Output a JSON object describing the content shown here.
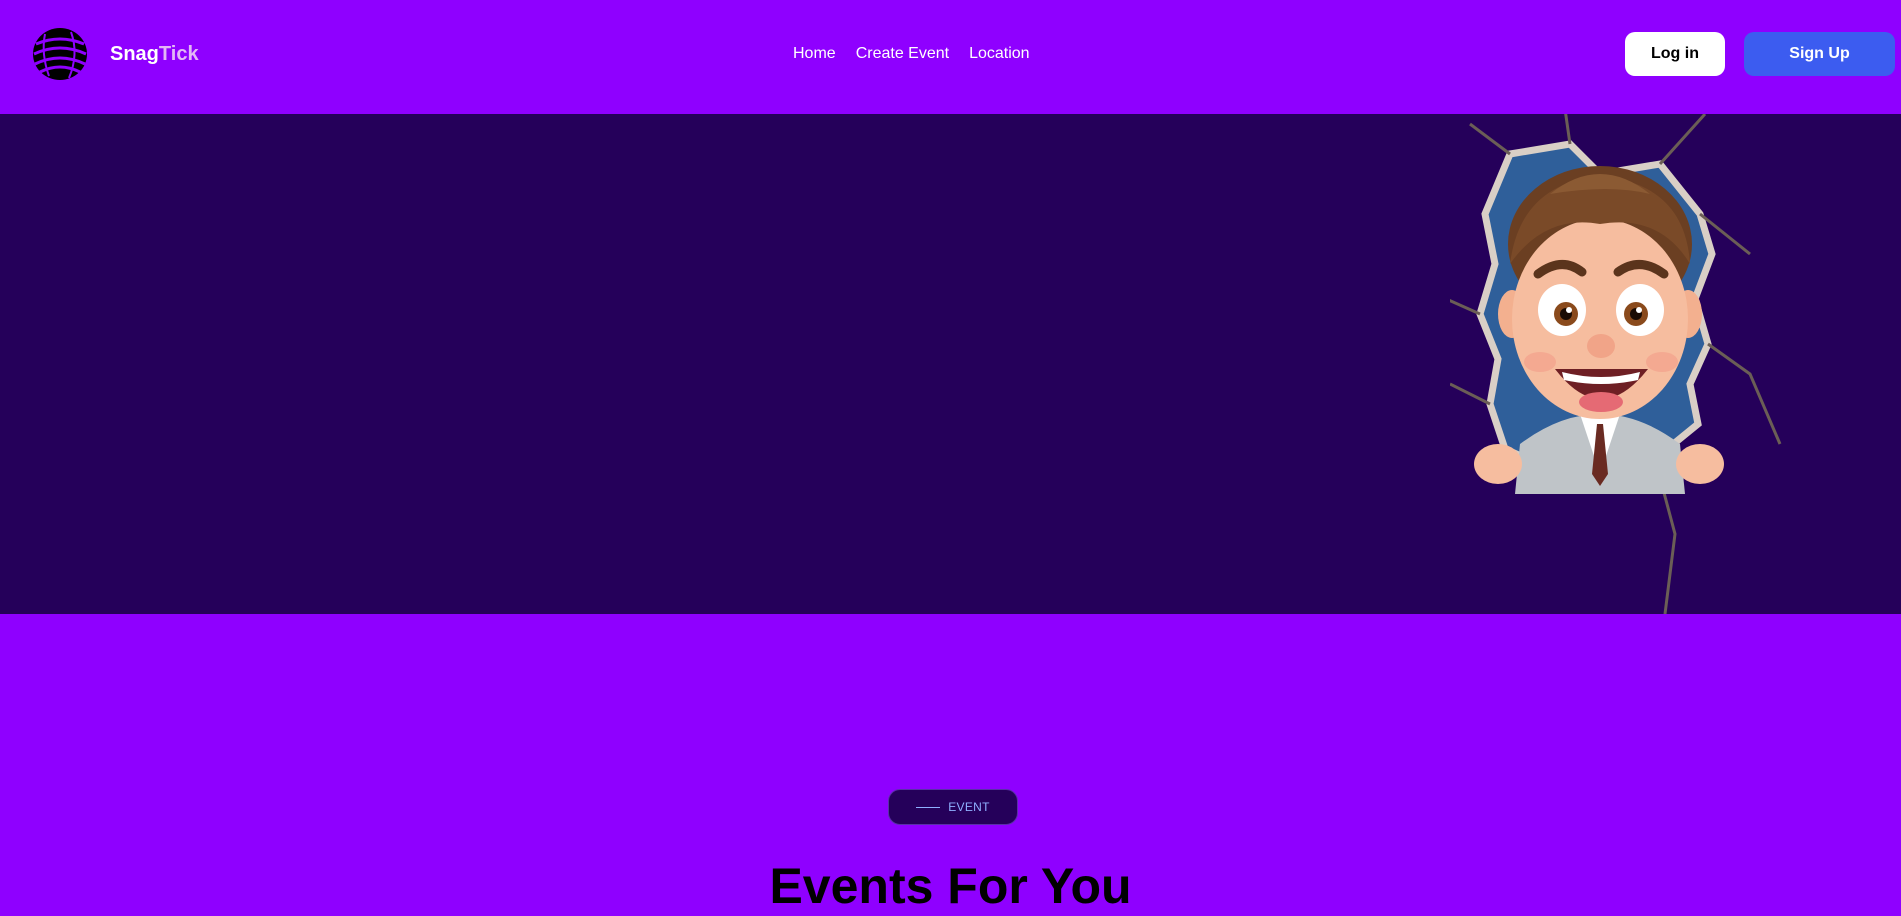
{
  "header": {
    "brand_part1": "Snag",
    "brand_part2": "Tick",
    "nav": [
      {
        "label": "Home"
      },
      {
        "label": "Create Event"
      },
      {
        "label": "Location"
      }
    ],
    "login_label": "Log in",
    "signup_label": "Sign Up"
  },
  "hero": {
    "illustration": "cartoon-boy-breaking-through-wall"
  },
  "events_section": {
    "pill_label": "EVENT",
    "title": "Events For You"
  },
  "colors": {
    "primary_purple": "#8f00ff",
    "hero_dark": "#25005a",
    "signup_blue": "#3c5cf0",
    "pill_text": "#8fb0ff"
  },
  "icons": [
    "logo-globe-icon"
  ]
}
